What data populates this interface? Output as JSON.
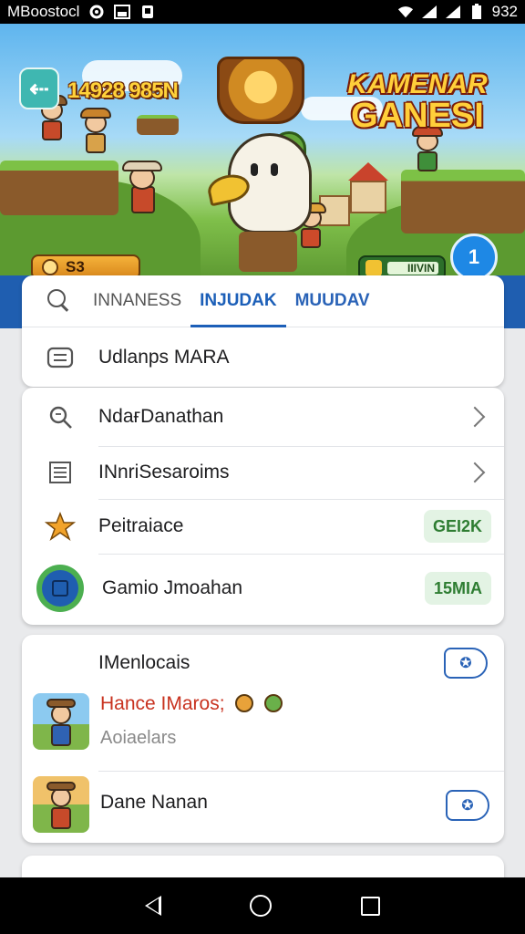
{
  "status_bar": {
    "app_text": "MBoostocl",
    "time": "932"
  },
  "hero": {
    "score": "14928 985N",
    "logo_line1": "KAMENAR",
    "logo_line2": "GANESI",
    "left_pill": "S3",
    "right_pill": "IIIVIN",
    "round_badge": "1"
  },
  "tabs": {
    "items": [
      {
        "label": "INNANESS",
        "active": false
      },
      {
        "label": "INJUDAK",
        "active": true
      },
      {
        "label": "MUUDAV",
        "active": false
      }
    ]
  },
  "search_row": {
    "label": "Udlanps MARA"
  },
  "menu": {
    "items": [
      {
        "label": "NdaғDanathan",
        "icon": "search-doc-icon",
        "trailing": "chevron"
      },
      {
        "label": "INnriSesaroims",
        "icon": "list-doc-icon",
        "trailing": "chevron"
      },
      {
        "label": "Peitraiace",
        "icon": "star-icon",
        "badge": "GEI2K"
      },
      {
        "label": "Gamio Jmoahan",
        "icon": "game-circle-icon",
        "badge": "15MIA"
      }
    ]
  },
  "feed": {
    "header": "IMenlocais",
    "item1_title": "Hance IMaros;",
    "item1_sub": "Aoiaelars",
    "item2_title": "Dane Nanan"
  },
  "colors": {
    "accent_blue": "#1c5fb8",
    "badge_green": "#2e7d32",
    "highlight_red": "#c8321f"
  }
}
